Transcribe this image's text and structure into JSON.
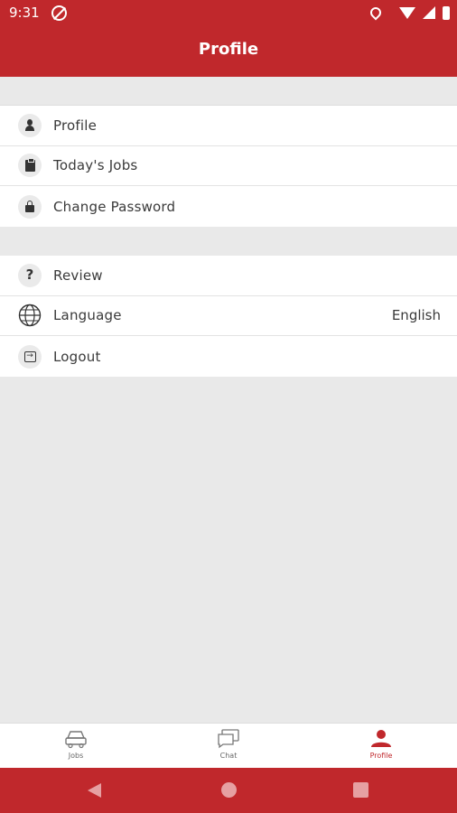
{
  "status_bar": {
    "time": "9:31"
  },
  "header": {
    "title": "Profile"
  },
  "menu_group_1": [
    {
      "label": "Profile",
      "icon": "person-icon"
    },
    {
      "label": "Today's Jobs",
      "icon": "clipboard-icon"
    },
    {
      "label": "Change Password",
      "icon": "lock-icon"
    }
  ],
  "menu_group_2": [
    {
      "label": "Review",
      "icon": "question-icon"
    },
    {
      "label": "Language",
      "value": "English",
      "icon": "globe-icon"
    },
    {
      "label": "Logout",
      "icon": "logout-icon"
    }
  ],
  "bottom_nav": [
    {
      "label": "Jobs",
      "icon": "car-icon",
      "active": false
    },
    {
      "label": "Chat",
      "icon": "chat-icon",
      "active": false
    },
    {
      "label": "Profile",
      "icon": "person-icon",
      "active": true
    }
  ],
  "colors": {
    "primary": "#c0282c",
    "background": "#e9e9e9",
    "text": "#3a3a3a"
  }
}
